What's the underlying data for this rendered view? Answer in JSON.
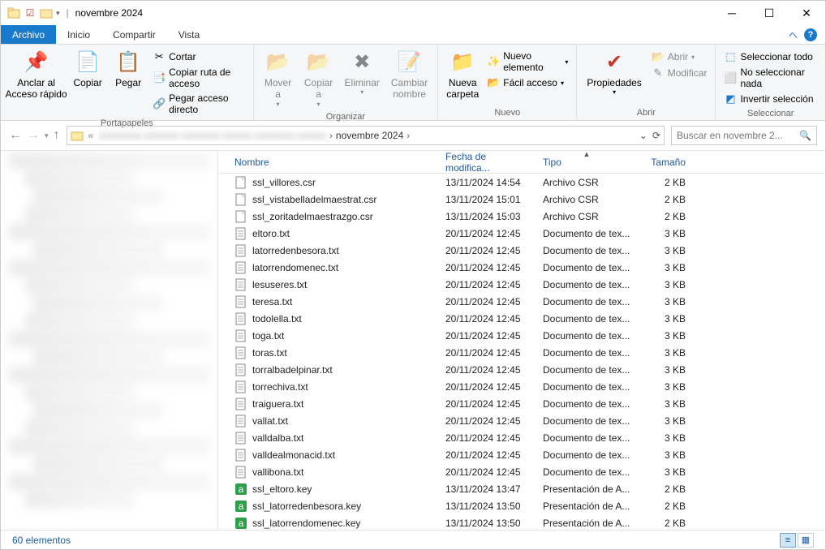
{
  "window": {
    "title": "novembre 2024"
  },
  "tabs": {
    "file": "Archivo",
    "home": "Inicio",
    "share": "Compartir",
    "view": "Vista"
  },
  "ribbon": {
    "pin": "Anclar al\nAcceso rápido",
    "copy": "Copiar",
    "paste": "Pegar",
    "cut": "Cortar",
    "copy_path": "Copiar ruta de acceso",
    "paste_shortcut": "Pegar acceso directo",
    "clipboard": "Portapapeles",
    "move_to": "Mover\na",
    "copy_to": "Copiar\na",
    "delete": "Eliminar",
    "rename": "Cambiar\nnombre",
    "organize": "Organizar",
    "new_folder": "Nueva\ncarpeta",
    "new_item": "Nuevo elemento",
    "easy_access": "Fácil acceso",
    "new": "Nuevo",
    "properties": "Propiedades",
    "open_btn": "Abrir",
    "edit": "Modificar",
    "open_group": "Abrir",
    "select_all": "Seleccionar todo",
    "select_none": "No seleccionar nada",
    "invert": "Invertir selección",
    "select": "Seleccionar"
  },
  "address": {
    "current": "novembre 2024"
  },
  "search": {
    "placeholder": "Buscar en novembre 2..."
  },
  "columns": {
    "name": "Nombre",
    "date": "Fecha de modifica...",
    "type": "Tipo",
    "size": "Tamaño"
  },
  "files": [
    {
      "icon": "csr",
      "name": "ssl_villores.csr",
      "date": "13/11/2024 14:54",
      "type": "Archivo CSR",
      "size": "2 KB"
    },
    {
      "icon": "csr",
      "name": "ssl_vistabelladelmaestrat.csr",
      "date": "13/11/2024 15:01",
      "type": "Archivo CSR",
      "size": "2 KB"
    },
    {
      "icon": "csr",
      "name": "ssl_zoritadelmaestrazgo.csr",
      "date": "13/11/2024 15:03",
      "type": "Archivo CSR",
      "size": "2 KB"
    },
    {
      "icon": "txt",
      "name": "eltoro.txt",
      "date": "20/11/2024 12:45",
      "type": "Documento de tex...",
      "size": "3 KB"
    },
    {
      "icon": "txt",
      "name": "latorredenbesora.txt",
      "date": "20/11/2024 12:45",
      "type": "Documento de tex...",
      "size": "3 KB"
    },
    {
      "icon": "txt",
      "name": "latorrendomenec.txt",
      "date": "20/11/2024 12:45",
      "type": "Documento de tex...",
      "size": "3 KB"
    },
    {
      "icon": "txt",
      "name": "lesuseres.txt",
      "date": "20/11/2024 12:45",
      "type": "Documento de tex...",
      "size": "3 KB"
    },
    {
      "icon": "txt",
      "name": "teresa.txt",
      "date": "20/11/2024 12:45",
      "type": "Documento de tex...",
      "size": "3 KB"
    },
    {
      "icon": "txt",
      "name": "todolella.txt",
      "date": "20/11/2024 12:45",
      "type": "Documento de tex...",
      "size": "3 KB"
    },
    {
      "icon": "txt",
      "name": "toga.txt",
      "date": "20/11/2024 12:45",
      "type": "Documento de tex...",
      "size": "3 KB"
    },
    {
      "icon": "txt",
      "name": "toras.txt",
      "date": "20/11/2024 12:45",
      "type": "Documento de tex...",
      "size": "3 KB"
    },
    {
      "icon": "txt",
      "name": "torralbadelpinar.txt",
      "date": "20/11/2024 12:45",
      "type": "Documento de tex...",
      "size": "3 KB"
    },
    {
      "icon": "txt",
      "name": "torrechiva.txt",
      "date": "20/11/2024 12:45",
      "type": "Documento de tex...",
      "size": "3 KB"
    },
    {
      "icon": "txt",
      "name": "traiguera.txt",
      "date": "20/11/2024 12:45",
      "type": "Documento de tex...",
      "size": "3 KB"
    },
    {
      "icon": "txt",
      "name": "vallat.txt",
      "date": "20/11/2024 12:45",
      "type": "Documento de tex...",
      "size": "3 KB"
    },
    {
      "icon": "txt",
      "name": "valldalba.txt",
      "date": "20/11/2024 12:45",
      "type": "Documento de tex...",
      "size": "3 KB"
    },
    {
      "icon": "txt",
      "name": "valldealmonacid.txt",
      "date": "20/11/2024 12:45",
      "type": "Documento de tex...",
      "size": "3 KB"
    },
    {
      "icon": "txt",
      "name": "vallibona.txt",
      "date": "20/11/2024 12:45",
      "type": "Documento de tex...",
      "size": "3 KB"
    },
    {
      "icon": "key",
      "name": "ssl_eltoro.key",
      "date": "13/11/2024 13:47",
      "type": "Presentación de A...",
      "size": "2 KB"
    },
    {
      "icon": "key",
      "name": "ssl_latorredenbesora.key",
      "date": "13/11/2024 13:50",
      "type": "Presentación de A...",
      "size": "2 KB"
    },
    {
      "icon": "key",
      "name": "ssl_latorrendomenec.key",
      "date": "13/11/2024 13:50",
      "type": "Presentación de A...",
      "size": "2 KB"
    }
  ],
  "status": {
    "count": "60 elementos"
  }
}
